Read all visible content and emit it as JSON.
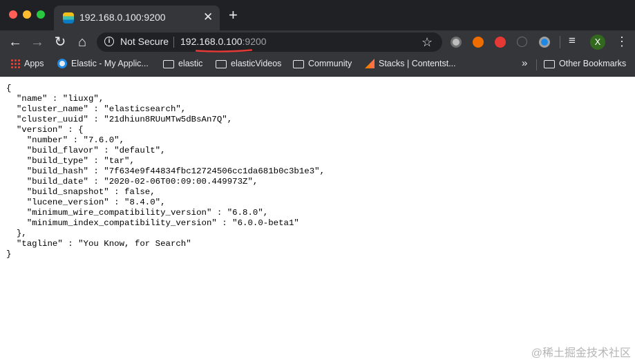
{
  "tab": {
    "title": "192.168.0.100:9200",
    "close_glyph": "✕",
    "new_tab_glyph": "+"
  },
  "toolbar": {
    "security_label": "Not Secure",
    "url_host": "192.168.0.100",
    "url_port": ":9200",
    "profile_initial": "X"
  },
  "bookmarks": {
    "items": [
      {
        "label": "Apps",
        "icon": "apps-grid-icon"
      },
      {
        "label": "Elastic - My Applic...",
        "icon": "elastic-icon"
      },
      {
        "label": "elastic",
        "icon": "folder-icon"
      },
      {
        "label": "elasticVideos",
        "icon": "folder-icon"
      },
      {
        "label": "Community",
        "icon": "folder-icon"
      },
      {
        "label": "Stacks | Contentst...",
        "icon": "contentstack-icon"
      }
    ],
    "overflow_glyph": "»",
    "other_label": "Other Bookmarks"
  },
  "page": {
    "lines": [
      "{",
      "  \"name\" : \"liuxg\",",
      "  \"cluster_name\" : \"elasticsearch\",",
      "  \"cluster_uuid\" : \"21dhiun8RUuMTw5dBsAn7Q\",",
      "  \"version\" : {",
      "    \"number\" : \"7.6.0\",",
      "    \"build_flavor\" : \"default\",",
      "    \"build_type\" : \"tar\",",
      "    \"build_hash\" : \"7f634e9f44834fbc12724506cc1da681b0c3b1e3\",",
      "    \"build_date\" : \"2020-02-06T00:09:00.449973Z\",",
      "    \"build_snapshot\" : false,",
      "    \"lucene_version\" : \"8.4.0\",",
      "    \"minimum_wire_compatibility_version\" : \"6.8.0\",",
      "    \"minimum_index_compatibility_version\" : \"6.0.0-beta1\"",
      "  },",
      "  \"tagline\" : \"You Know, for Search\"",
      "}"
    ]
  },
  "watermark": "@稀土掘金技术社区",
  "colors": {
    "chrome_dark": "#202124",
    "toolbar": "#35363a",
    "annotation_red": "#e53935"
  }
}
